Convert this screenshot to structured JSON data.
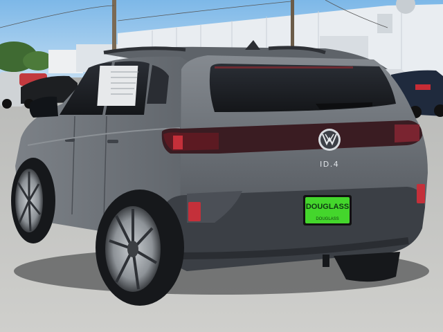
{
  "vehicle": {
    "model_badge": "ID.4",
    "brand_logo": "vw-logo-icon"
  },
  "license_plate": {
    "dealer_name": "DOUGLASS",
    "dealer_subtext": "DOUGLASS"
  },
  "colors": {
    "sky": "#8fc3ea",
    "building": "#e9edf1",
    "car_body": "#6a6f75",
    "car_shadow": "#3f4349",
    "plate_green": "#44d62c",
    "asphalt": "#c9c9c6",
    "taillight": "#b01f2a"
  },
  "window_sticker": "window-sticker-icon"
}
